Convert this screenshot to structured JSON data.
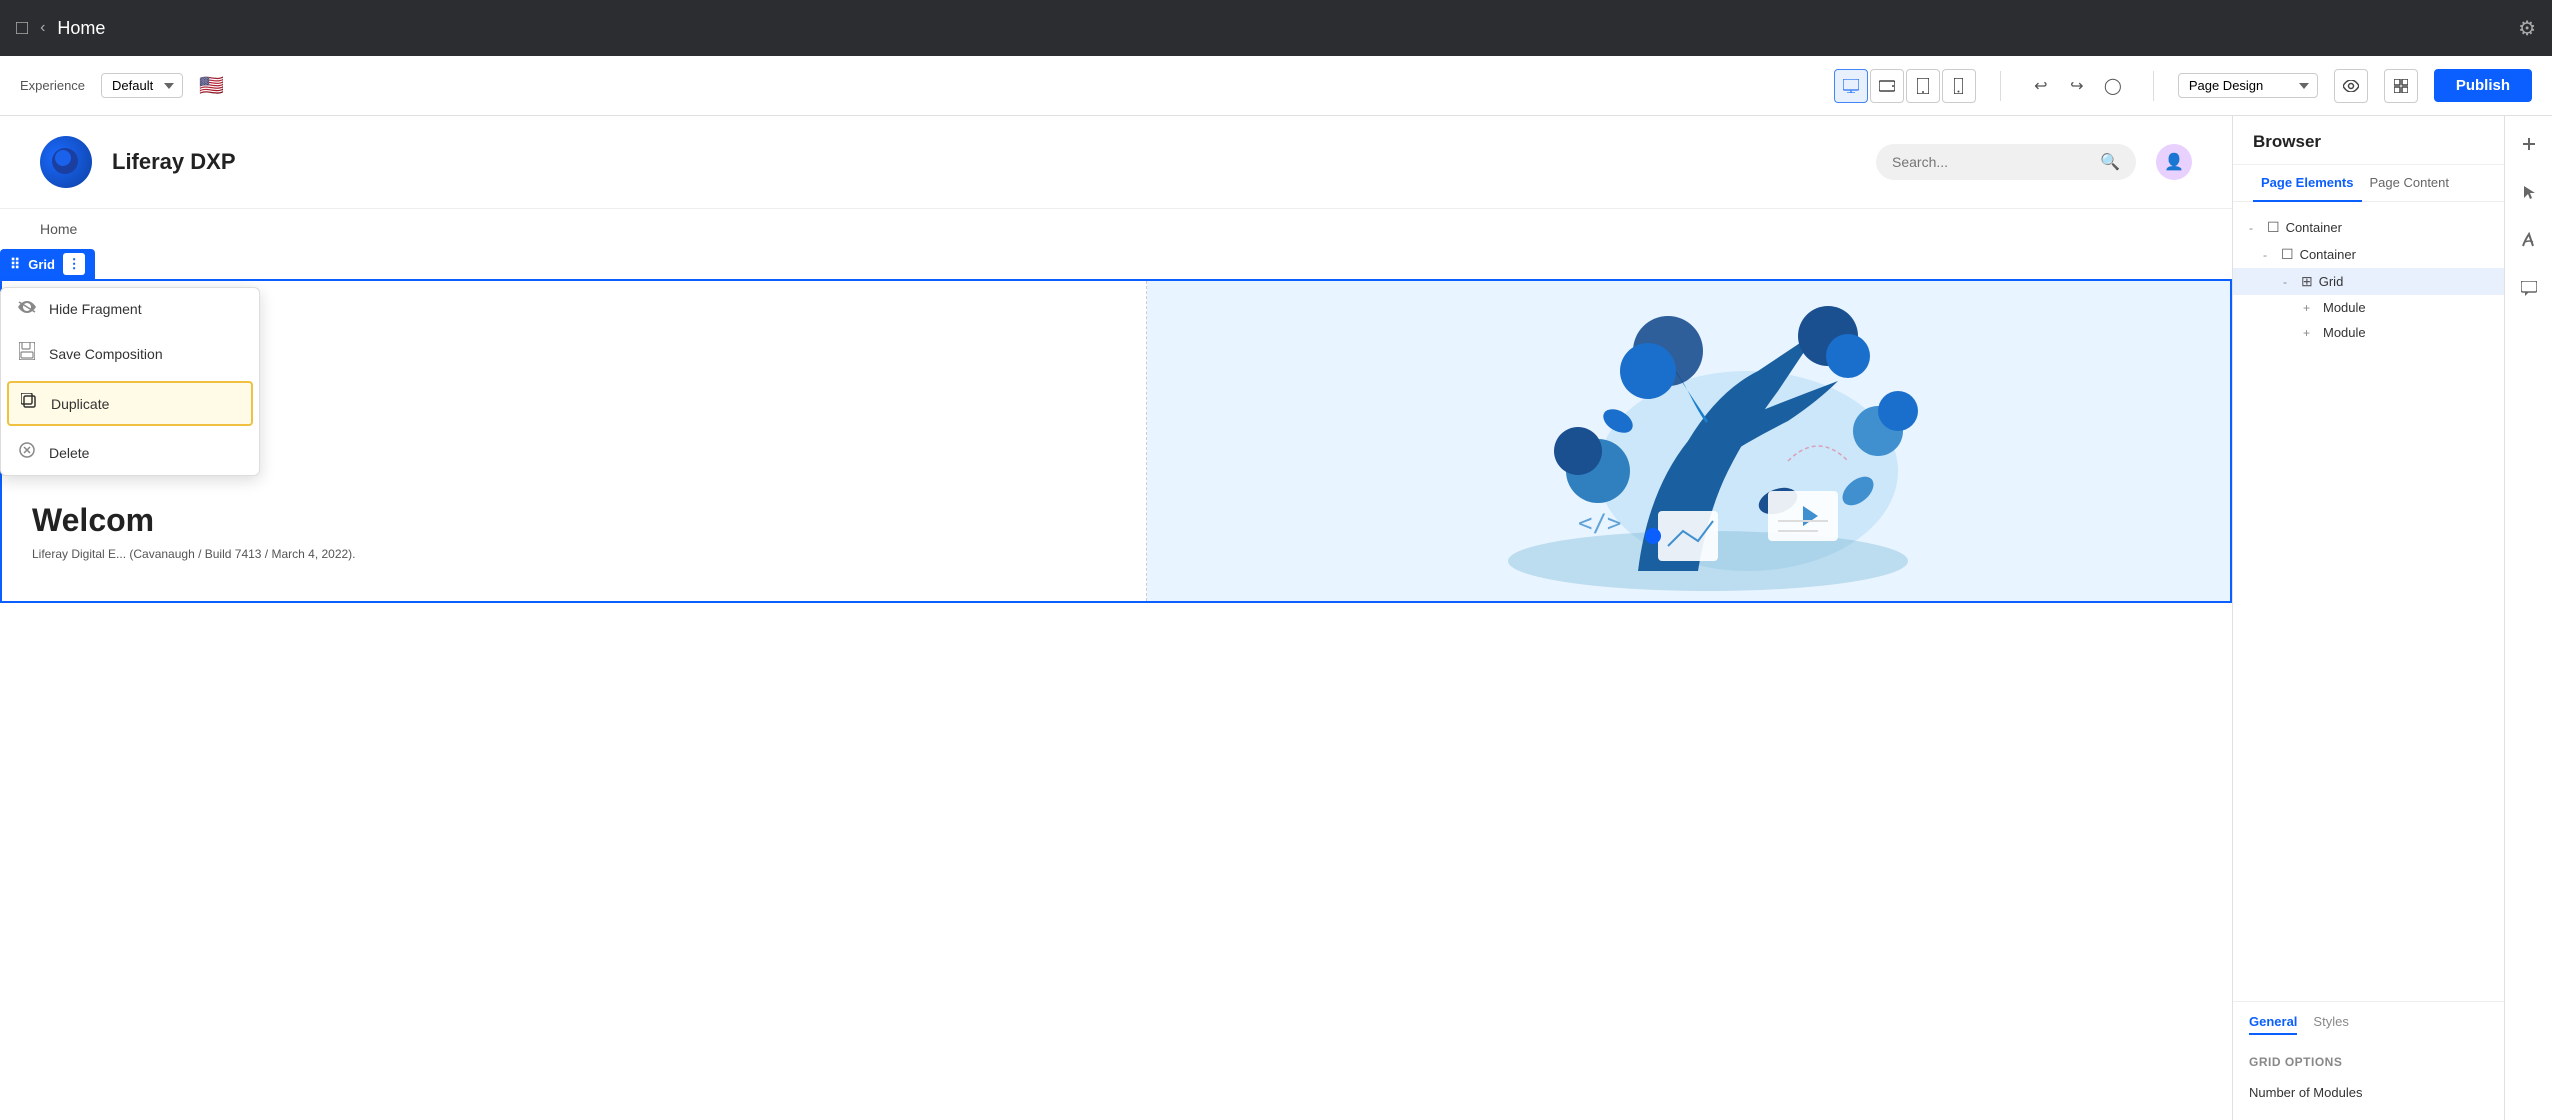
{
  "topBar": {
    "sidebarToggle": "☰",
    "backArrow": "‹",
    "title": "Home",
    "gearIcon": "⚙"
  },
  "toolbar": {
    "experienceLabel": "Experience",
    "experienceValue": "Default",
    "viewButtons": [
      {
        "icon": "🖥",
        "label": "desktop",
        "active": true
      },
      {
        "icon": "⬜",
        "label": "tablet-landscape",
        "active": false
      },
      {
        "icon": "⬜",
        "label": "tablet-portrait",
        "active": false
      },
      {
        "icon": "📱",
        "label": "mobile",
        "active": false
      }
    ],
    "undoIcon": "↩",
    "redoIcon": "↪",
    "historyIcon": "🕐",
    "pageDesignLabel": "Page Design",
    "publishLabel": "Publish"
  },
  "pageHeader": {
    "siteName": "Liferay DXP",
    "searchPlaceholder": "Search...",
    "searchIcon": "🔍",
    "userAvatarIcon": "👤"
  },
  "breadcrumb": {
    "label": "Home"
  },
  "fragmentBar": {
    "dragIcon": "⠿",
    "label": "Grid",
    "menuIcon": "⋮"
  },
  "contextMenu": {
    "items": [
      {
        "icon": "👁",
        "label": "Hide Fragment",
        "highlighted": false
      },
      {
        "icon": "💾",
        "label": "Save Composition",
        "highlighted": false
      },
      {
        "icon": "⧉",
        "label": "Duplicate",
        "highlighted": true
      },
      {
        "icon": "⊗",
        "label": "Delete",
        "highlighted": false
      }
    ]
  },
  "gridContent": {
    "welcomeText": "Welcom",
    "descText": "Liferay Digital E... (Cavanaugh / Build 7413 / March 4, 2022)."
  },
  "rightPanel": {
    "title": "Browser",
    "tabs": [
      {
        "label": "Page Elements",
        "active": true
      },
      {
        "label": "Page Content",
        "active": false
      }
    ],
    "tree": [
      {
        "level": 0,
        "toggle": "-",
        "icon": "☐",
        "label": "Container",
        "selected": false
      },
      {
        "level": 1,
        "toggle": "-",
        "icon": "☐",
        "label": "Container",
        "selected": false
      },
      {
        "level": 2,
        "toggle": "-",
        "icon": "⊞",
        "label": "Grid",
        "selected": true,
        "showEye": true,
        "showX": true
      },
      {
        "level": 3,
        "toggle": "+",
        "icon": "",
        "label": "Module",
        "selected": false
      },
      {
        "level": 3,
        "toggle": "+",
        "icon": "",
        "label": "Module",
        "selected": false
      }
    ],
    "generalTab": "General",
    "stylesTab": "Styles",
    "gridOptionsLabel": "GRID OPTIONS",
    "numModulesLabel": "Number of Modules"
  },
  "sideIcons": [
    {
      "icon": "+",
      "name": "add-icon"
    },
    {
      "icon": "▶",
      "name": "play-icon"
    },
    {
      "icon": "🖌",
      "name": "paint-icon"
    },
    {
      "icon": "💬",
      "name": "chat-icon"
    }
  ]
}
